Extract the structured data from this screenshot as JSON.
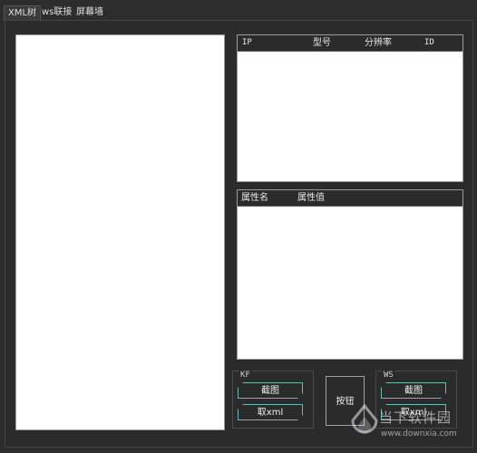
{
  "tabs": [
    {
      "label": "XML树",
      "active": true
    },
    {
      "label": "ws联接",
      "active": false
    },
    {
      "label": "屏幕墙",
      "active": false
    }
  ],
  "device_table": {
    "columns": [
      "IP",
      "型号",
      "分辨率",
      "ID"
    ]
  },
  "property_table": {
    "columns": [
      "属性名",
      "属性值"
    ]
  },
  "kf_group": {
    "title": "KF",
    "screenshot_label": "截图",
    "getxml_label": "取xml"
  },
  "ws_group": {
    "title": "WS",
    "screenshot_label": "截图",
    "getxml_label": "取xml"
  },
  "center_button_label": "按钮",
  "watermark": {
    "logo": "当下软件园",
    "url": "www.downxia.com"
  },
  "colors": {
    "background": "#2d2d2d",
    "accent_border": "#6fb7b7",
    "list_background": "#ffffff"
  }
}
